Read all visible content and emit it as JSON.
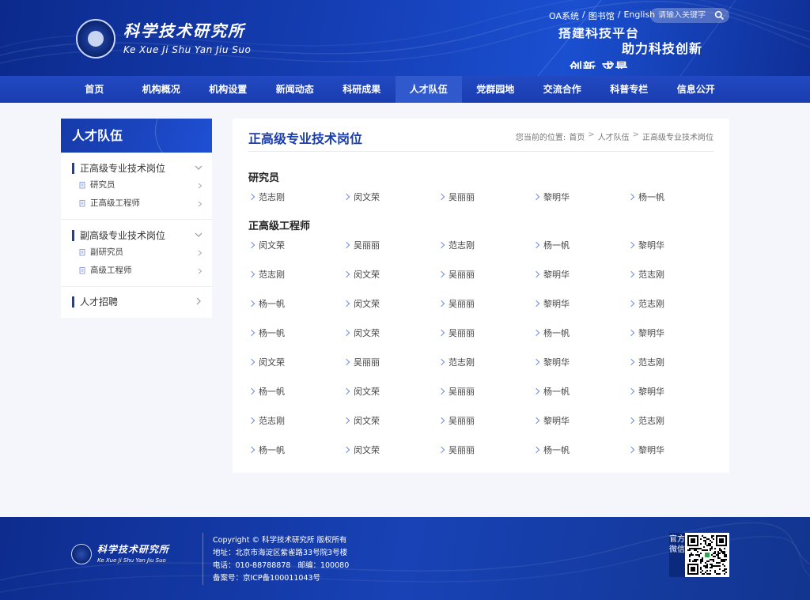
{
  "header": {
    "logo_cn": "科学技术研究所",
    "logo_en": "Ke Xue Ji Shu Yan Jiu Suo",
    "top_links": [
      "OA系统",
      "图书馆",
      "English"
    ],
    "link_separator": "/",
    "search_placeholder": "请输入关键字",
    "slogans": [
      "搭建科技平台",
      "助力科技创新",
      "创新 求是"
    ]
  },
  "nav": {
    "items": [
      "首页",
      "机构概况",
      "机构设置",
      "新闻动态",
      "科研成果",
      "人才队伍",
      "党群园地",
      "交流合作",
      "科普专栏",
      "信息公开"
    ],
    "active_index": 5
  },
  "sidebar": {
    "title": "人才队伍",
    "groups": [
      {
        "label": "正高级专业技术岗位",
        "children": [
          "研究员",
          "正高级工程师"
        ]
      },
      {
        "label": "副高级专业技术岗位",
        "children": [
          "副研究员",
          "高级工程师"
        ]
      },
      {
        "label": "人才招聘",
        "children": []
      }
    ]
  },
  "main": {
    "title": "正高级专业技术岗位",
    "breadcrumb": {
      "prefix": "您当前的位置:",
      "items": [
        "首页",
        "人才队伍",
        "正高级专业技术岗位"
      ],
      "separator": ">"
    },
    "sections": [
      {
        "title": "研究员",
        "rows": [
          [
            "范志刚",
            "闵文荣",
            "吴丽丽",
            "黎明华",
            "杨一帆"
          ]
        ]
      },
      {
        "title": "正高级工程师",
        "rows": [
          [
            "闵文荣",
            "吴丽丽",
            "范志刚",
            "杨一帆",
            "黎明华"
          ],
          [
            "范志刚",
            "闵文荣",
            "吴丽丽",
            "黎明华",
            "范志刚"
          ],
          [
            "杨一帆",
            "闵文荣",
            "吴丽丽",
            "黎明华",
            "范志刚"
          ],
          [
            "杨一帆",
            "闵文荣",
            "吴丽丽",
            "杨一帆",
            "黎明华"
          ],
          [
            "闵文荣",
            "吴丽丽",
            "范志刚",
            "黎明华",
            "范志刚"
          ],
          [
            "杨一帆",
            "闵文荣",
            "吴丽丽",
            "杨一帆",
            "黎明华"
          ],
          [
            "范志刚",
            "闵文荣",
            "吴丽丽",
            "黎明华",
            "范志刚"
          ],
          [
            "杨一帆",
            "闵文荣",
            "吴丽丽",
            "杨一帆",
            "黎明华"
          ]
        ]
      }
    ]
  },
  "footer": {
    "logo_cn": "科学技术研究所",
    "logo_en": "Ke Xue Ji Shu Yan Jiu Suo",
    "copyright": "Copyright © 科学技术研究所 版权所有",
    "address": "地址：北京市海淀区紫雀路33号院3号楼",
    "contact": "电话：010-88788878   邮编：100080",
    "icp": "备案号：京ICP备100011043号",
    "qr_label": "官方微信"
  },
  "colors": {
    "brand_blue": "#1a3db0",
    "nav_active": "#1e4bc8",
    "page_bg": "#f4f6fb"
  },
  "icons": {
    "search": "search-icon",
    "chevron_down": "chevron-down-icon",
    "chevron_right": "chevron-right-icon",
    "document": "document-icon",
    "qr_code": "qr-code-icon",
    "emblem": "emblem-icon"
  }
}
